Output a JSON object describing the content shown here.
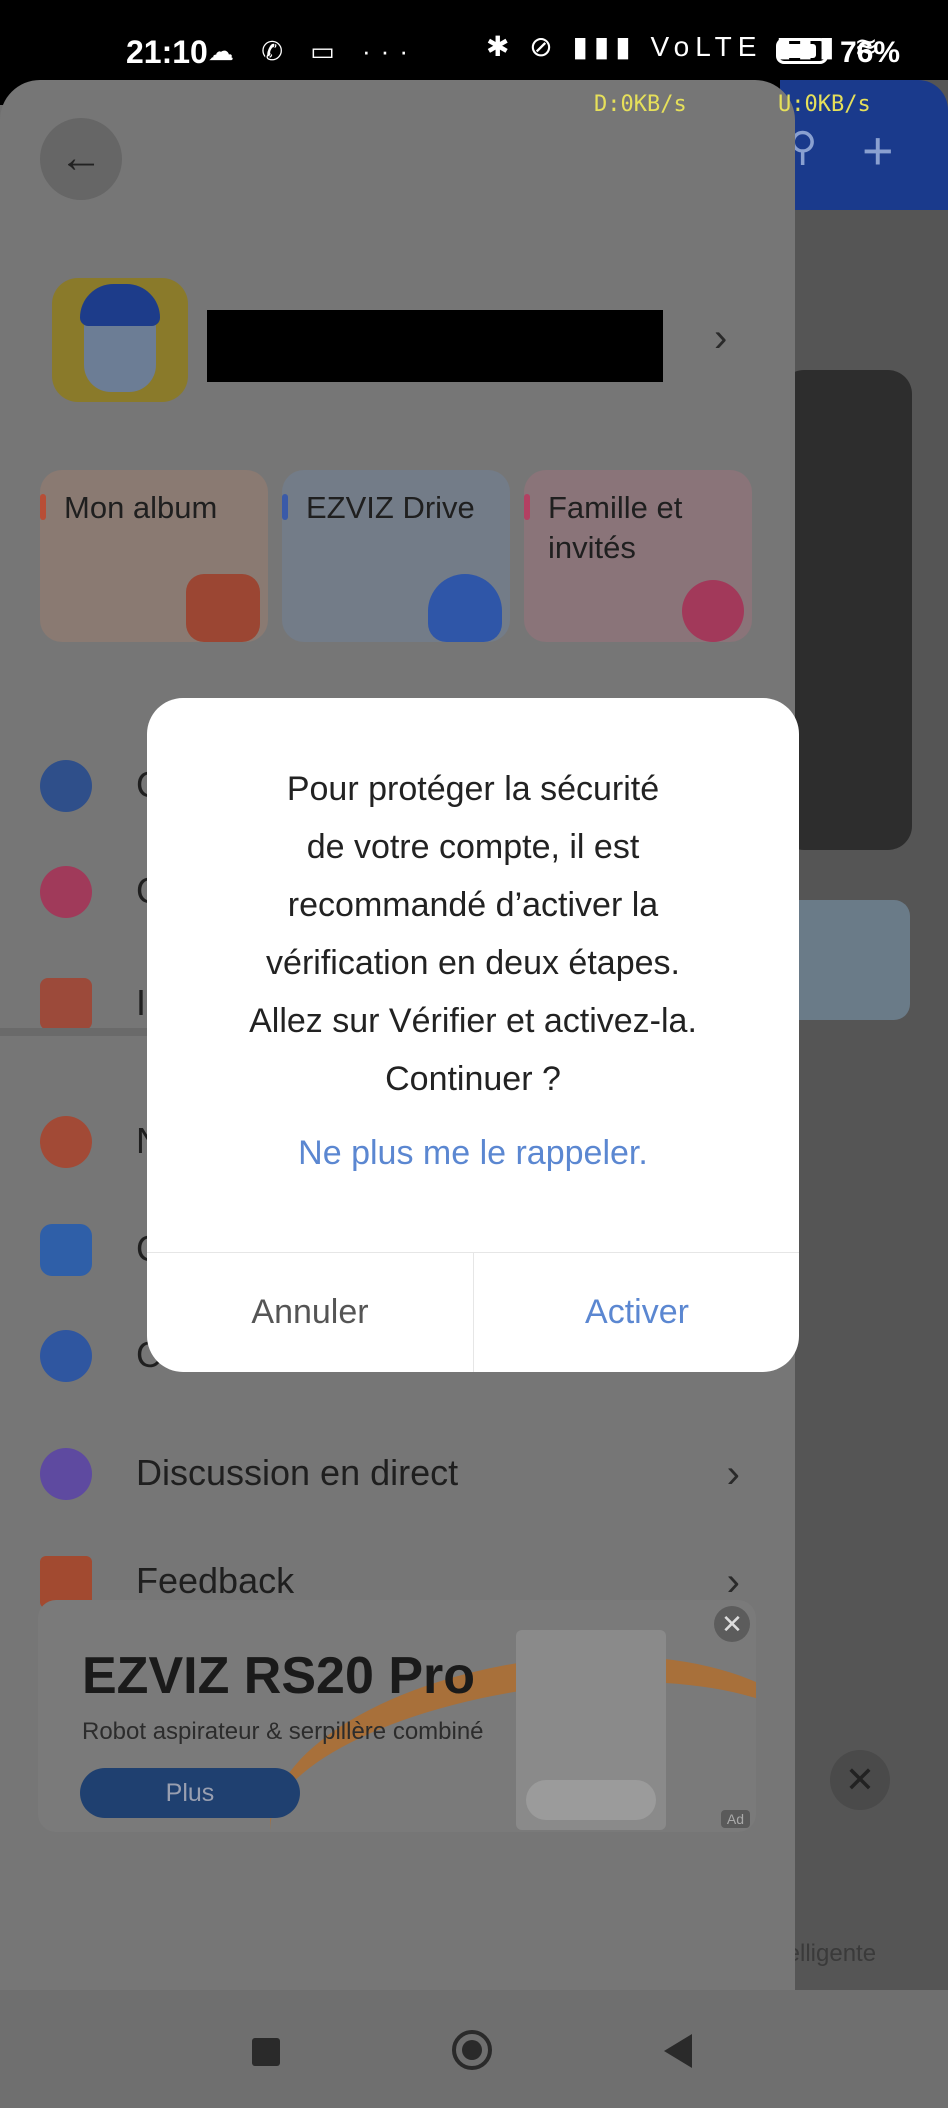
{
  "status_bar": {
    "time": "21:10",
    "left_icons": "☁ ✆ ▭ ···",
    "right_icons": "✱ ⊘ ▮▮▮ VoLTE ▮▮▮ ≋",
    "battery": "76%",
    "download": "D:0KB/s",
    "upload": "U:0KB/s"
  },
  "drawer": {
    "tiles": [
      {
        "label": "Mon album",
        "color": "#e0523a"
      },
      {
        "label": "EZVIZ Drive",
        "color": "#3c6fd8"
      },
      {
        "label": "Famille et invités",
        "color": "#e04a70"
      }
    ],
    "menu_partial": [
      {
        "label": "C",
        "icon": "gear-icon",
        "color": "#2f5fd0"
      },
      {
        "label": "C",
        "icon": "play-circle-icon",
        "color": "#e0326a"
      },
      {
        "label": "I",
        "icon": "star-icon",
        "color": "#e25a3a"
      },
      {
        "label": "N",
        "icon": "leaf-icon",
        "color": "#e45434"
      },
      {
        "label": "C",
        "icon": "shield-check-icon",
        "color": "#3a78dc"
      },
      {
        "label": "C",
        "icon": "info-bubble-icon",
        "color": "#3a6fd8"
      }
    ],
    "menu_full": [
      {
        "label": "Discussion en direct",
        "icon": "chat-bubble-icon",
        "color": "#7a56d8"
      },
      {
        "label": "Feedback",
        "icon": "paper-plane-icon",
        "color": "#e4542e"
      }
    ]
  },
  "ad": {
    "title": "EZVIZ RS20 Pro",
    "subtitle": "Robot aspirateur & serpillère combiné",
    "button": "Plus",
    "close": "✕",
    "tag": "Ad"
  },
  "background": {
    "partial_label": "telligente"
  },
  "dialog": {
    "message": "Pour protéger la sécurité de votre compte, il est recommandé d’activer la vérification en deux étapes. Allez sur Vérifier et activez-la. Continuer ?",
    "message_lines": [
      "Pour protéger la sécurité",
      "de votre compte, il est",
      "recommandé d’activer la",
      "vérification en deux étapes.",
      "Allez sur Vérifier et activez-la.",
      "Continuer ?"
    ],
    "dont_remind": "Ne plus me le rappeler.",
    "cancel": "Annuler",
    "activate": "Activer"
  }
}
